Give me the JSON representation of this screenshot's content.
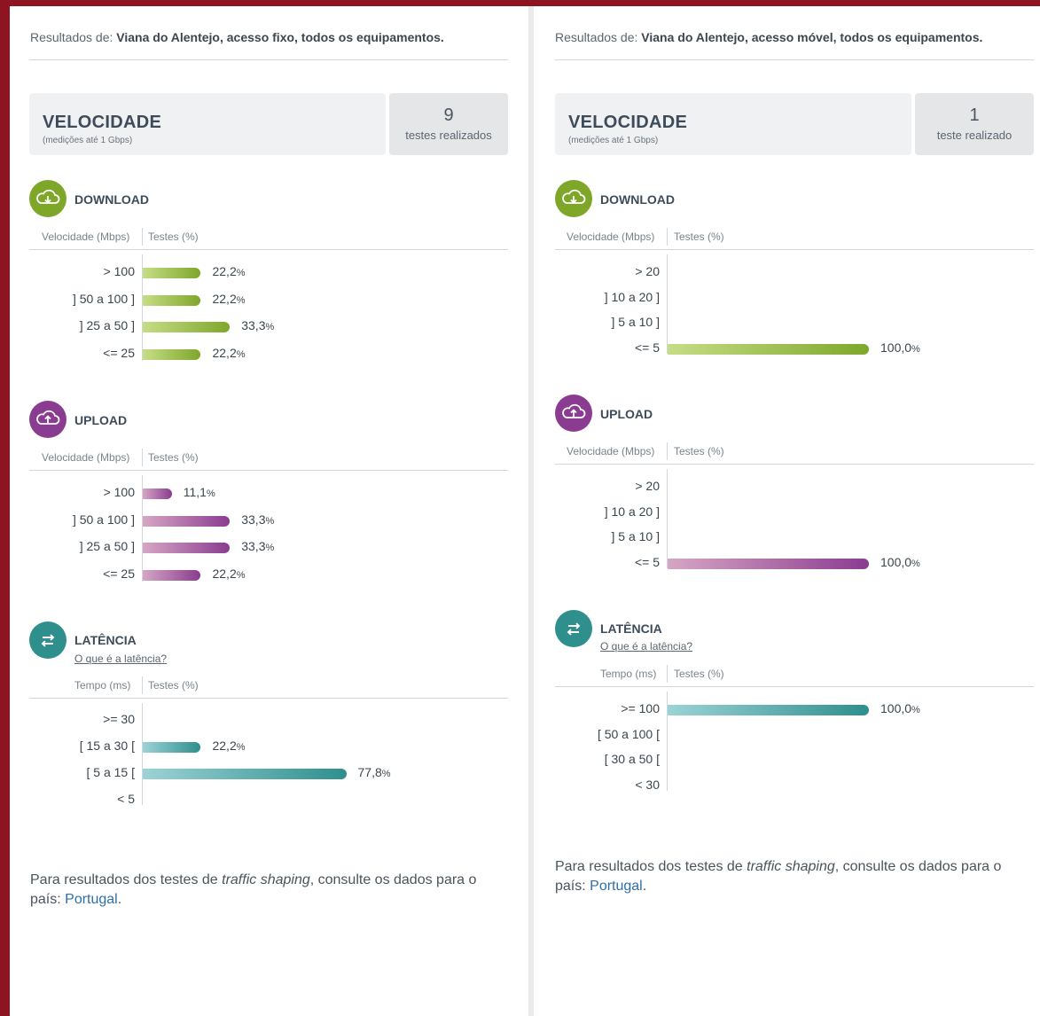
{
  "panels": [
    {
      "results_prefix": "Resultados de:",
      "results_text": "Viana do Alentejo, acesso fixo, todos os equipamentos.",
      "speed_title": "VELOCIDADE",
      "speed_subtitle": "(medições até 1 Gbps)",
      "test_count": "9",
      "test_count_label": "testes realizados",
      "download": {
        "title": "DOWNLOAD",
        "col_left": "Velocidade (Mbps)",
        "col_right": "Testes (%)",
        "rows": [
          {
            "label": "> 100",
            "pct": 22.2,
            "value": "22,2",
            "unit": "%"
          },
          {
            "label": "] 50 a 100 ]",
            "pct": 22.2,
            "value": "22,2",
            "unit": "%"
          },
          {
            "label": "] 25 a 50 ]",
            "pct": 33.3,
            "value": "33,3",
            "unit": "%"
          },
          {
            "label": "<= 25",
            "pct": 22.2,
            "value": "22,2",
            "unit": "%"
          }
        ]
      },
      "upload": {
        "title": "UPLOAD",
        "col_left": "Velocidade (Mbps)",
        "col_right": "Testes (%)",
        "rows": [
          {
            "label": "> 100",
            "pct": 11.1,
            "value": "11,1",
            "unit": "%"
          },
          {
            "label": "] 50 a 100 ]",
            "pct": 33.3,
            "value": "33,3",
            "unit": "%"
          },
          {
            "label": "] 25 a 50 ]",
            "pct": 33.3,
            "value": "33,3",
            "unit": "%"
          },
          {
            "label": "<= 25",
            "pct": 22.2,
            "value": "22,2",
            "unit": "%"
          }
        ]
      },
      "latency": {
        "title": "LATÊNCIA",
        "link": "O que é a latência?",
        "col_left": "Tempo (ms)",
        "col_right": "Testes (%)",
        "rows": [
          {
            "label": ">= 30",
            "pct": 0,
            "value": "",
            "unit": ""
          },
          {
            "label": "[ 15 a 30 [",
            "pct": 22.2,
            "value": "22,2",
            "unit": "%"
          },
          {
            "label": "[ 5 a 15 [",
            "pct": 77.8,
            "value": "77,8",
            "unit": "%"
          },
          {
            "label": "< 5",
            "pct": 0,
            "value": "",
            "unit": ""
          }
        ]
      },
      "footer": {
        "before": "Para resultados dos testes de ",
        "italic": "traffic shaping",
        "after": ", consulte os dados para o país: ",
        "link": "Portugal",
        "end": "."
      }
    },
    {
      "results_prefix": "Resultados de:",
      "results_text": "Viana do Alentejo, acesso móvel, todos os equipamentos.",
      "speed_title": "VELOCIDADE",
      "speed_subtitle": "(medições até 1 Gbps)",
      "test_count": "1",
      "test_count_label": "teste realizado",
      "download": {
        "title": "DOWNLOAD",
        "col_left": "Velocidade (Mbps)",
        "col_right": "Testes (%)",
        "rows": [
          {
            "label": "> 20",
            "pct": 0,
            "value": "",
            "unit": ""
          },
          {
            "label": "] 10 a 20 ]",
            "pct": 0,
            "value": "",
            "unit": ""
          },
          {
            "label": "] 5 a 10 ]",
            "pct": 0,
            "value": "",
            "unit": ""
          },
          {
            "label": "<= 5",
            "pct": 100,
            "value": "100,0",
            "unit": "%"
          }
        ]
      },
      "upload": {
        "title": "UPLOAD",
        "col_left": "Velocidade (Mbps)",
        "col_right": "Testes (%)",
        "rows": [
          {
            "label": "> 20",
            "pct": 0,
            "value": "",
            "unit": ""
          },
          {
            "label": "] 10 a 20 ]",
            "pct": 0,
            "value": "",
            "unit": ""
          },
          {
            "label": "] 5 a 10 ]",
            "pct": 0,
            "value": "",
            "unit": ""
          },
          {
            "label": "<= 5",
            "pct": 100,
            "value": "100,0",
            "unit": "%"
          }
        ]
      },
      "latency": {
        "title": "LATÊNCIA",
        "link": "O que é a latência?",
        "col_left": "Tempo (ms)",
        "col_right": "Testes (%)",
        "rows": [
          {
            "label": ">= 100",
            "pct": 100,
            "value": "100,0",
            "unit": "%"
          },
          {
            "label": "[ 50 a 100 [",
            "pct": 0,
            "value": "",
            "unit": ""
          },
          {
            "label": "[ 30 a 50 [",
            "pct": 0,
            "value": "",
            "unit": ""
          },
          {
            "label": "< 30",
            "pct": 0,
            "value": "",
            "unit": ""
          }
        ]
      },
      "footer": {
        "before": "Para resultados dos testes de ",
        "italic": "traffic shaping",
        "after": ", consulte os dados para o país: ",
        "link": "Portugal",
        "end": "."
      }
    }
  ],
  "colors": {
    "frame": "#8e1421",
    "download": "#7ea72a",
    "upload": "#8a3c90",
    "latency": "#2e8f8d"
  },
  "icons": {
    "download": "cloud-download-icon",
    "upload": "cloud-upload-icon",
    "latency": "arrows-exchange-icon"
  }
}
